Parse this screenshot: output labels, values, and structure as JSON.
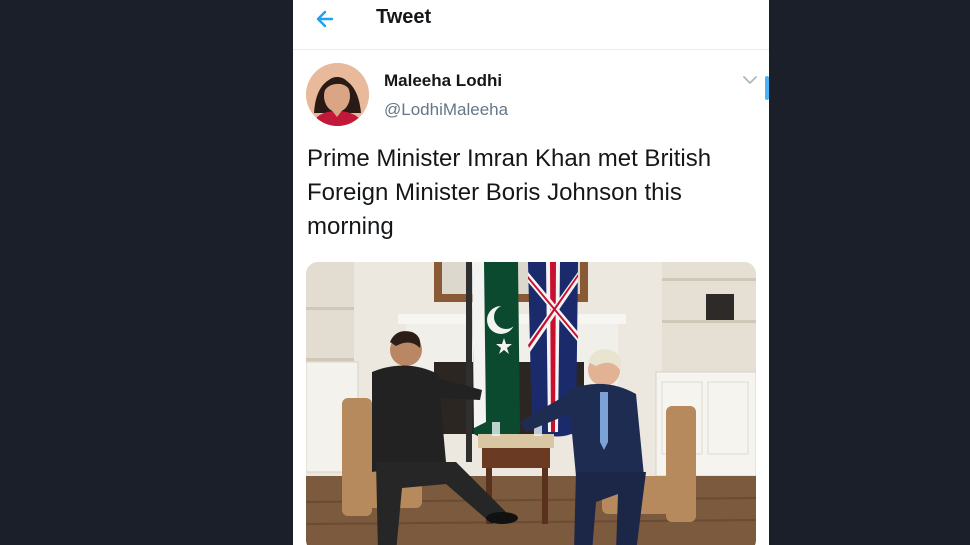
{
  "header": {
    "title": "Tweet",
    "back_icon": "arrow-left-icon"
  },
  "tweet": {
    "author_name": "Maleeha Lodhi",
    "author_handle": "@LodhiMaleeha",
    "text": "Prime Minister Imran Khan met British Foreign Minister Boris Johnson this morning",
    "menu_icon": "chevron-down-icon"
  },
  "colors": {
    "accent": "#1da1f2",
    "page_background": "#1b1f2a",
    "text": "#14171a",
    "secondary_text": "#657786"
  }
}
